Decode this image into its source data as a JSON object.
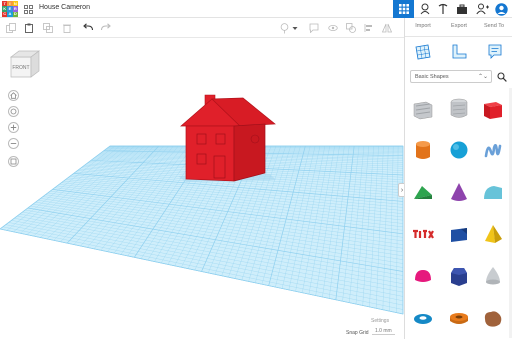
{
  "app": {
    "logo_letters": [
      "T",
      "I",
      "N",
      "K",
      "E",
      "R",
      "C",
      "A",
      "D"
    ],
    "logo_colors": [
      "#e3342f",
      "#f6993f",
      "#f9c513",
      "#38a169",
      "#3490dc",
      "#9561e2",
      "#e3342f",
      "#1a9ed9",
      "#6cb33e"
    ]
  },
  "header": {
    "design_title": "House Cameron"
  },
  "panel": {
    "tabs": [
      "Import",
      "Export",
      "Send To"
    ],
    "category": "Basic Shapes",
    "category_caret": "⌃⌄"
  },
  "workplane": {
    "view_cube_label": "FRONT",
    "settings_label": "Settings",
    "snap_grid_label": "Snap Grid",
    "snap_grid_value": "1.0 mm",
    "collapse_glyph": "›"
  },
  "shapes": [
    {
      "name": "box-hole",
      "color": "#b9bcc0"
    },
    {
      "name": "cylinder-hole",
      "color": "#b9bcc0"
    },
    {
      "name": "box",
      "color": "#e0202a"
    },
    {
      "name": "cylinder",
      "color": "#ef7d1b"
    },
    {
      "name": "sphere",
      "color": "#17a0d6"
    },
    {
      "name": "scribble",
      "color": "#6aa0d8"
    },
    {
      "name": "roof",
      "color": "#2ea44f"
    },
    {
      "name": "cone",
      "color": "#8e44ad"
    },
    {
      "name": "round-roof",
      "color": "#67c3d9"
    },
    {
      "name": "text",
      "color": "#d52b2b"
    },
    {
      "name": "wedge",
      "color": "#1f4fa3"
    },
    {
      "name": "pyramid",
      "color": "#f0c419"
    },
    {
      "name": "half-sphere",
      "color": "#e6197d"
    },
    {
      "name": "polygon",
      "color": "#2a3f8f"
    },
    {
      "name": "paraboloid",
      "color": "#c8ccd0"
    },
    {
      "name": "torus",
      "color": "#1589c6"
    },
    {
      "name": "tube",
      "color": "#e87b1c"
    },
    {
      "name": "organic",
      "color": "#a0623b"
    }
  ],
  "colors": {
    "accent": "#1477d1",
    "house": "#e0202a",
    "grid_line": "#8fd0ef",
    "grid_fill": "#cfeefb"
  }
}
